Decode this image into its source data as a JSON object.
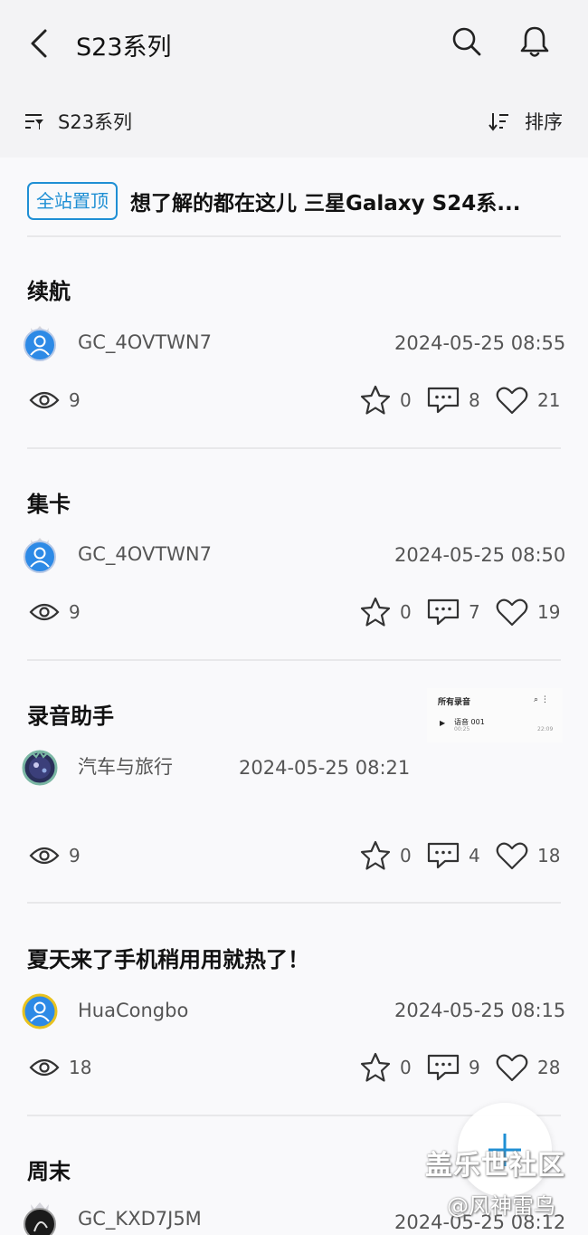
{
  "header": {
    "title": "S23系列"
  },
  "subbar": {
    "filter_label": "S23系列",
    "sort_label": "排序"
  },
  "pinned": {
    "badge": "全站置顶",
    "title": "想了解的都在这儿 三星Galaxy S24系..."
  },
  "posts": [
    {
      "title": "续航",
      "author": "GC_4OVTWN7",
      "time": "2024-05-25 08:55",
      "views": "9",
      "favorites": "0",
      "comments": "8",
      "likes": "21"
    },
    {
      "title": "集卡",
      "author": "GC_4OVTWN7",
      "time": "2024-05-25 08:50",
      "views": "9",
      "favorites": "0",
      "comments": "7",
      "likes": "19"
    },
    {
      "title": "录音助手",
      "author": "汽车与旅行",
      "time": "2024-05-25 08:21",
      "views": "9",
      "favorites": "0",
      "comments": "4",
      "likes": "18",
      "thumbnail": {
        "header": "所有录音",
        "item": "语音 001",
        "sub": "00:25",
        "duration": "22:09"
      }
    },
    {
      "title": "夏天来了手机稍用用就热了！",
      "author": "HuaCongbo",
      "time": "2024-05-25 08:15",
      "views": "18",
      "favorites": "0",
      "comments": "9",
      "likes": "28"
    },
    {
      "title": "周末",
      "author": "GC_KXD7J5M",
      "time": "2024-05-25 08:12"
    }
  ],
  "watermark": {
    "line1": "盖乐世社区",
    "line2": "@风神雷鸟"
  },
  "colors": {
    "accent": "#1f8fd4",
    "avatar_blue": "#2d8ae6",
    "bar_bg": "#f3f3f5"
  }
}
